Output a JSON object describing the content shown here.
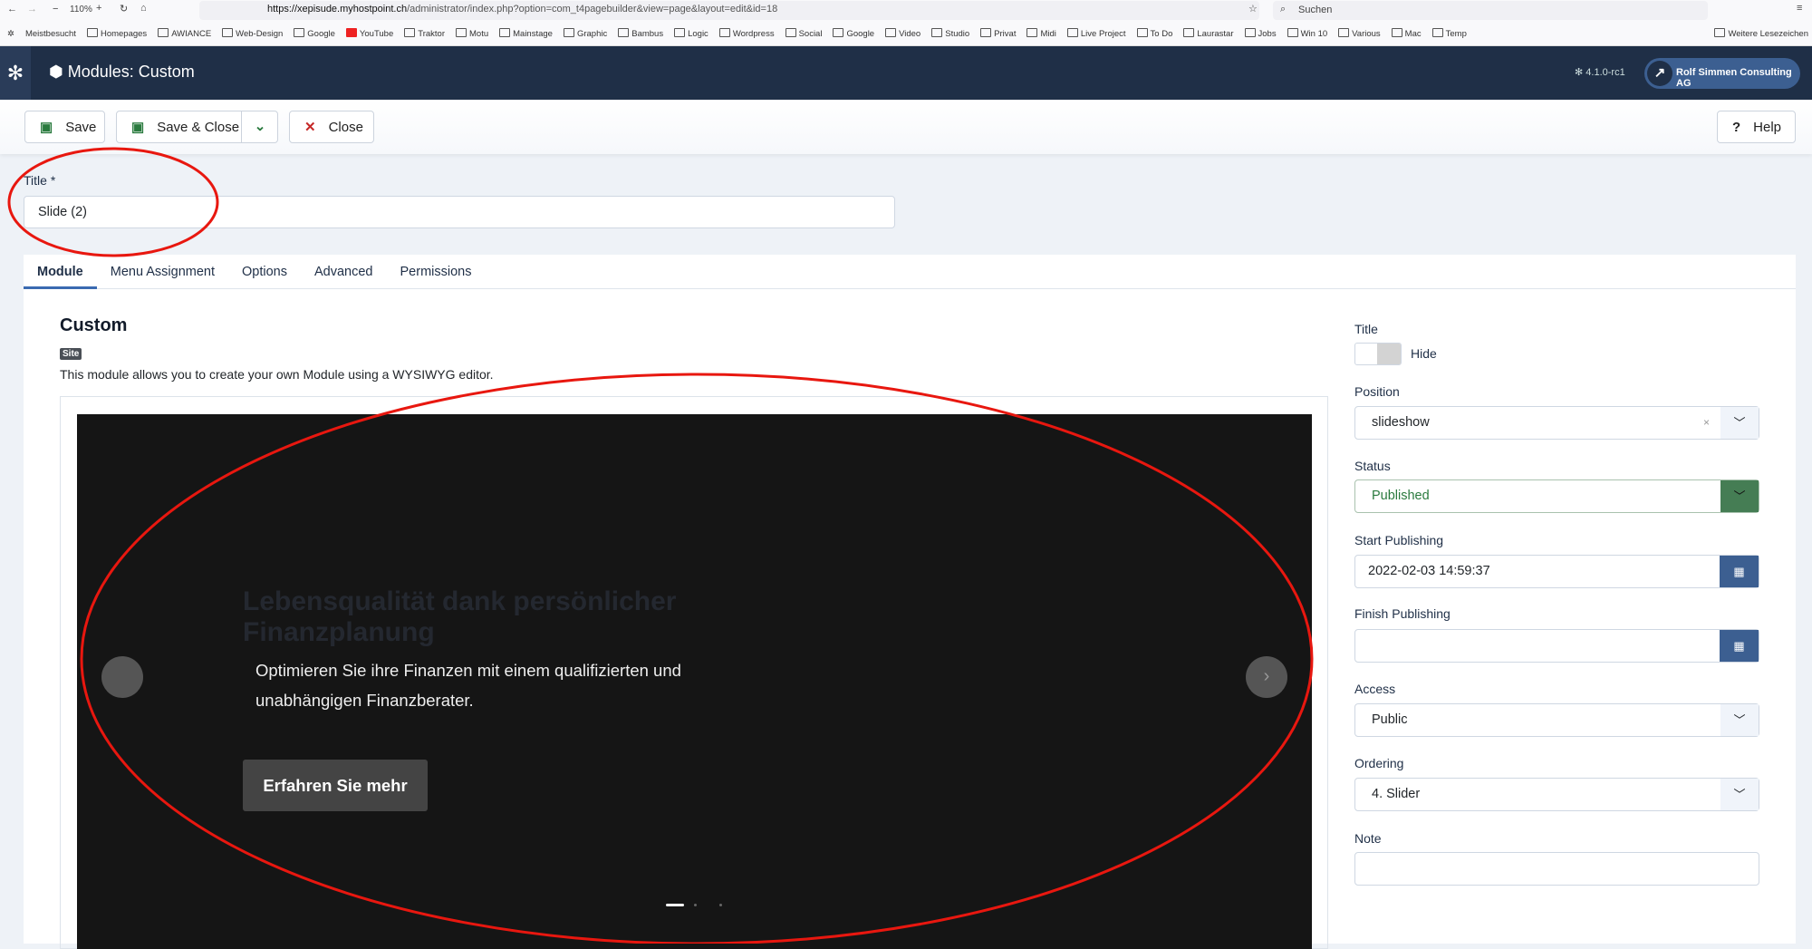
{
  "browser": {
    "zoom": "110%",
    "url_host": "https://xepisude.myhostpoint.ch",
    "url_path": "/administrator/index.php?option=com_t4pagebuilder&view=page&layout=edit&id=18",
    "search_placeholder": "Suchen"
  },
  "bookmarks": [
    "Meistbesucht",
    "Homepages",
    "AWIANCE",
    "Web-Design",
    "Google",
    "YouTube",
    "Traktor",
    "Motu",
    "Mainstage",
    "Graphic",
    "Bambus",
    "Logic",
    "Wordpress",
    "Social",
    "Google",
    "Video",
    "Studio",
    "Privat",
    "Midi",
    "Live Project",
    "To Do",
    "Laurastar",
    "Jobs",
    "Win 10",
    "Various",
    "Mac",
    "Temp"
  ],
  "more_bookmarks": "Weitere Lesezeichen",
  "header": {
    "title": "Modules: Custom",
    "version": "4.1.0-rc1",
    "user": "Rolf Simmen Consulting AG"
  },
  "toolbar": {
    "save": "Save",
    "save_close": "Save & Close",
    "close": "Close",
    "help": "Help"
  },
  "title_field": {
    "label": "Title *",
    "value": "Slide (2)"
  },
  "tabs": [
    "Module",
    "Menu Assignment",
    "Options",
    "Advanced",
    "Permissions"
  ],
  "module": {
    "heading": "Custom",
    "badge": "Site",
    "description": "This module allows you to create your own Module using a WYSIWYG editor."
  },
  "slide": {
    "heading": "Lebensqualität dank persönlicher Finanzplanung",
    "text": "Optimieren Sie ihre Finanzen mit einem qualifizierten und unabhängigen Finanzberater.",
    "button": "Erfahren Sie mehr",
    "current_slide": 1,
    "total_slides": 3
  },
  "sidebar": {
    "title_label": "Title",
    "title_toggle": "Hide",
    "position_label": "Position",
    "position": "slideshow",
    "status_label": "Status",
    "status": "Published",
    "start_label": "Start Publishing",
    "start": "2022-02-03 14:59:37",
    "finish_label": "Finish Publishing",
    "finish": "",
    "access_label": "Access",
    "access": "Public",
    "ordering_label": "Ordering",
    "ordering": "4. Slider",
    "note_label": "Note",
    "note": ""
  },
  "colors": {
    "header": "#1f2f47",
    "accent": "#3c5f91",
    "status_green": "#457d54",
    "annotation": "#e8170f"
  }
}
